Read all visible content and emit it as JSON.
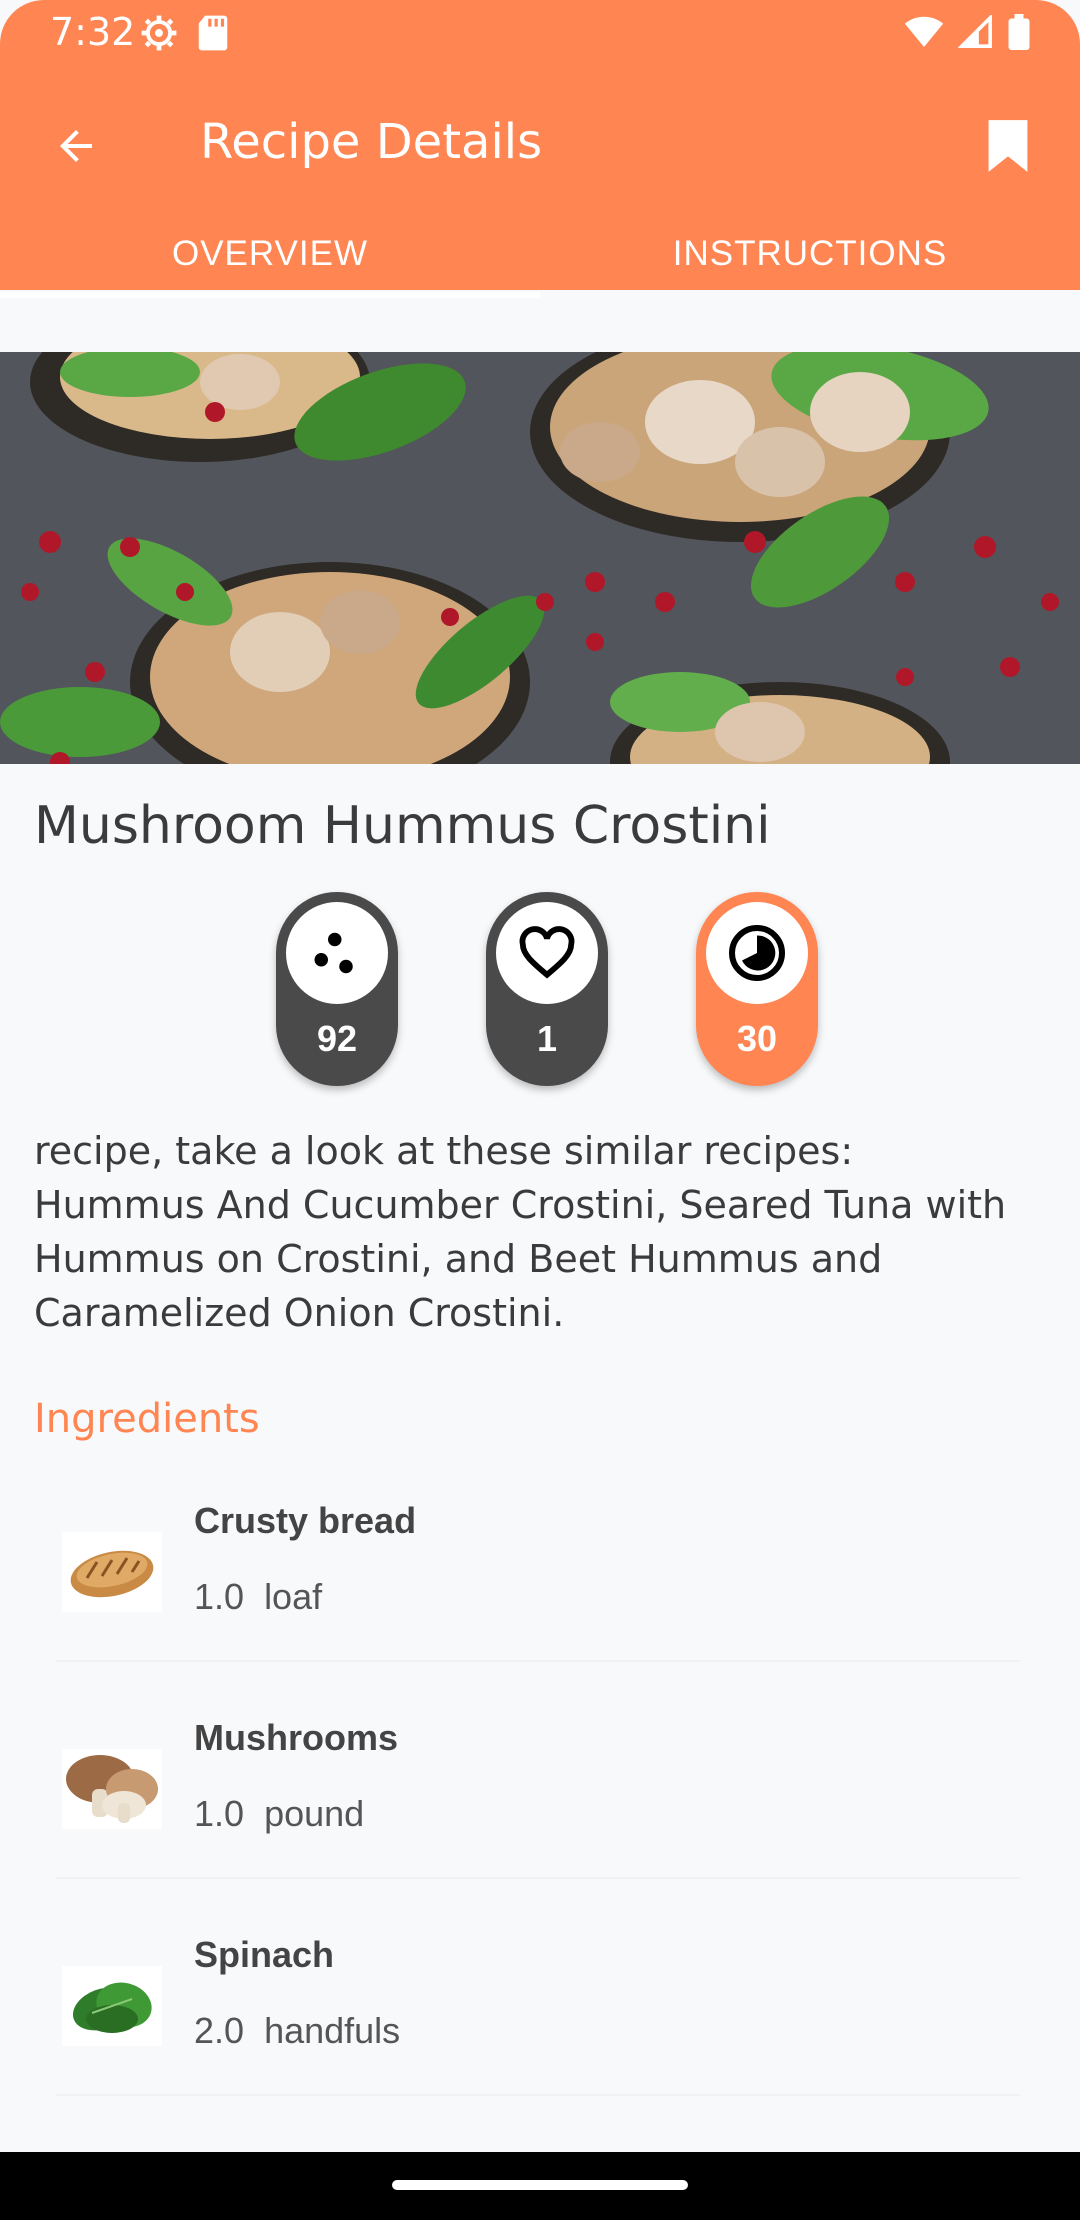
{
  "status_bar": {
    "time": "7:32"
  },
  "app_bar": {
    "title": "Recipe Details"
  },
  "tabs": [
    {
      "label": "OVERVIEW",
      "active": true
    },
    {
      "label": "INSTRUCTIONS",
      "active": false
    }
  ],
  "recipe": {
    "title": "Mushroom Hummus Crostini",
    "stats": {
      "score": "92",
      "likes": "1",
      "time": "30"
    },
    "description": "recipe, take a look at these similar recipes: Hummus And Cucumber Crostini, Seared Tuna with Hummus on Crostini, and Beet Hummus and Caramelized Onion Crostini."
  },
  "ingredients_section": {
    "title": "Ingredients",
    "items": [
      {
        "name": "Crusty bread",
        "amount": "1.0",
        "unit": "loaf",
        "icon": "bread-icon"
      },
      {
        "name": "Mushrooms",
        "amount": "1.0",
        "unit": "pound",
        "icon": "mushroom-icon"
      },
      {
        "name": "Spinach",
        "amount": "2.0",
        "unit": "handfuls",
        "icon": "spinach-icon"
      }
    ]
  },
  "colors": {
    "accent": "#FF8552",
    "dark_pill": "#4A4A4A",
    "text": "#3B3B3B"
  }
}
